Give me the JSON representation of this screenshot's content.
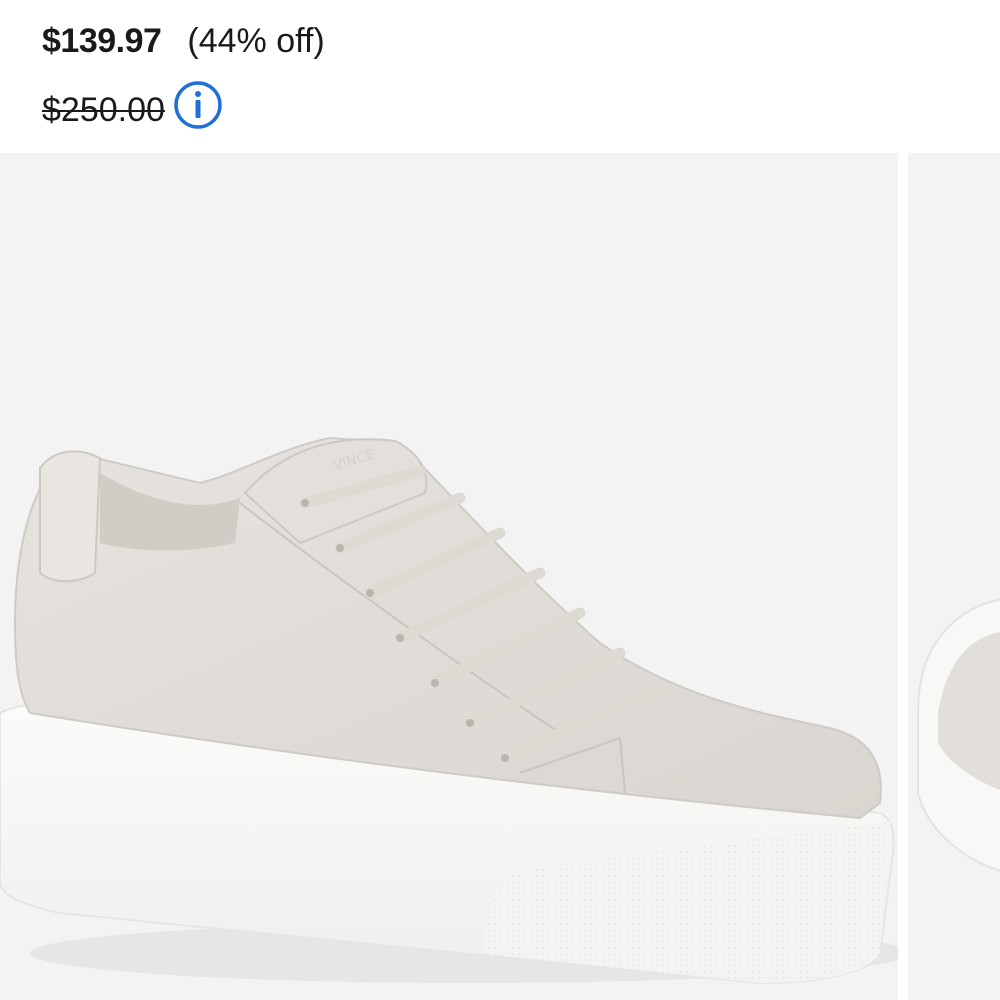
{
  "price": {
    "sale": "$139.97",
    "discount": "(44% off)",
    "original": "$250.00"
  },
  "gallery": {
    "main_image": "sneaker-image",
    "next_image": "sneaker-image-partial",
    "shoe_logo": "VINCE"
  },
  "colors": {
    "info_icon": "#1f6fd6",
    "text": "#1a1a1a",
    "image_background": "#f3f3f3"
  }
}
